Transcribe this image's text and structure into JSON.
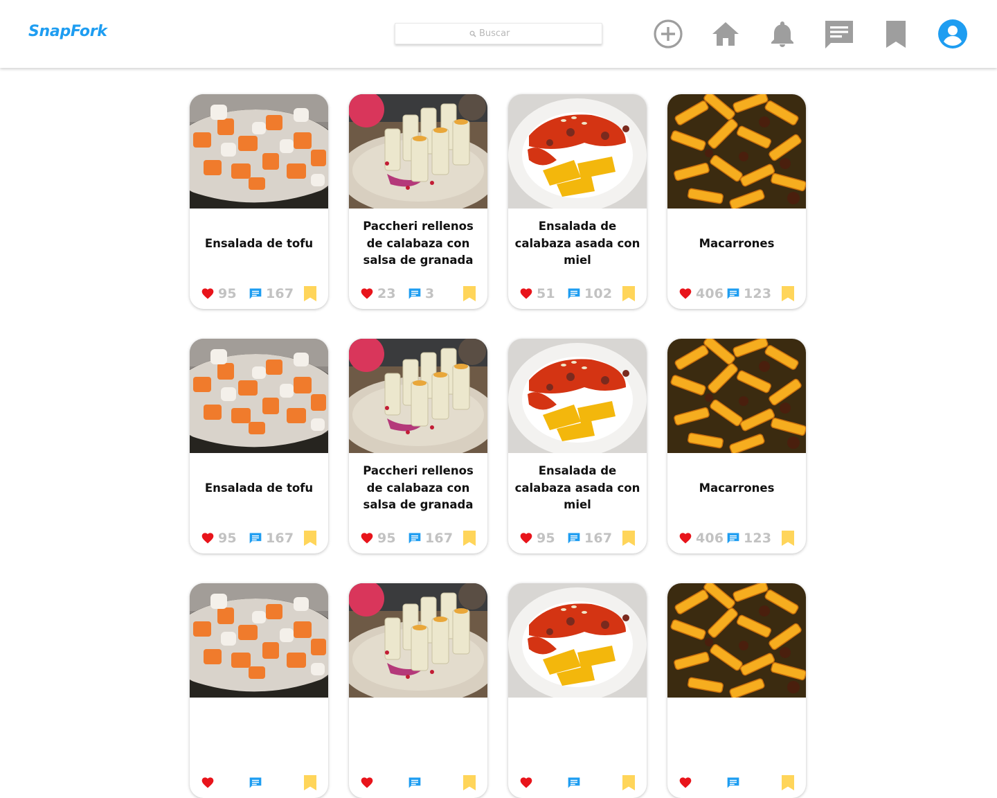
{
  "app": {
    "name": "SnapFork"
  },
  "search": {
    "placeholder": "Buscar"
  },
  "nav": [
    {
      "name": "add-icon",
      "label": "add"
    },
    {
      "name": "home-icon",
      "label": "home"
    },
    {
      "name": "bell-icon",
      "label": "notifications"
    },
    {
      "name": "chat-icon",
      "label": "messages"
    },
    {
      "name": "bookmark-icon",
      "label": "saved"
    },
    {
      "name": "account-icon",
      "label": "profile"
    }
  ],
  "colors": {
    "brand": "#1e9df1",
    "like": "#e8141b",
    "comment": "#1e9df1",
    "bookmark": "#ffd55a",
    "icon_gray": "#9e9e9e"
  },
  "recipes": [
    {
      "title": "Ensalada de tofu",
      "likes": "95",
      "comments": "167",
      "photo": "tofu-salad"
    },
    {
      "title": "Paccheri rellenos de calabaza con salsa de granada",
      "likes": "23",
      "comments": "3",
      "photo": "paccheri"
    },
    {
      "title": "Ensalada de calabaza asada con miel",
      "likes": "51",
      "comments": "102",
      "photo": "pumpkin-salad"
    },
    {
      "title": "Macarrones",
      "likes": "406",
      "comments": "123",
      "photo": "macaroni"
    },
    {
      "title": "Ensalada de tofu",
      "likes": "95",
      "comments": "167",
      "photo": "tofu-salad"
    },
    {
      "title": "Paccheri rellenos de calabaza con salsa de granada",
      "likes": "95",
      "comments": "167",
      "photo": "paccheri"
    },
    {
      "title": "Ensalada de calabaza asada con miel",
      "likes": "95",
      "comments": "167",
      "photo": "pumpkin-salad"
    },
    {
      "title": "Macarrones",
      "likes": "406",
      "comments": "123",
      "photo": "macaroni"
    },
    {
      "title": "",
      "likes": "",
      "comments": "",
      "photo": "tofu-salad"
    },
    {
      "title": "",
      "likes": "",
      "comments": "",
      "photo": "paccheri"
    },
    {
      "title": "",
      "likes": "",
      "comments": "",
      "photo": "pumpkin-salad"
    },
    {
      "title": "",
      "likes": "",
      "comments": "",
      "photo": "macaroni"
    }
  ]
}
